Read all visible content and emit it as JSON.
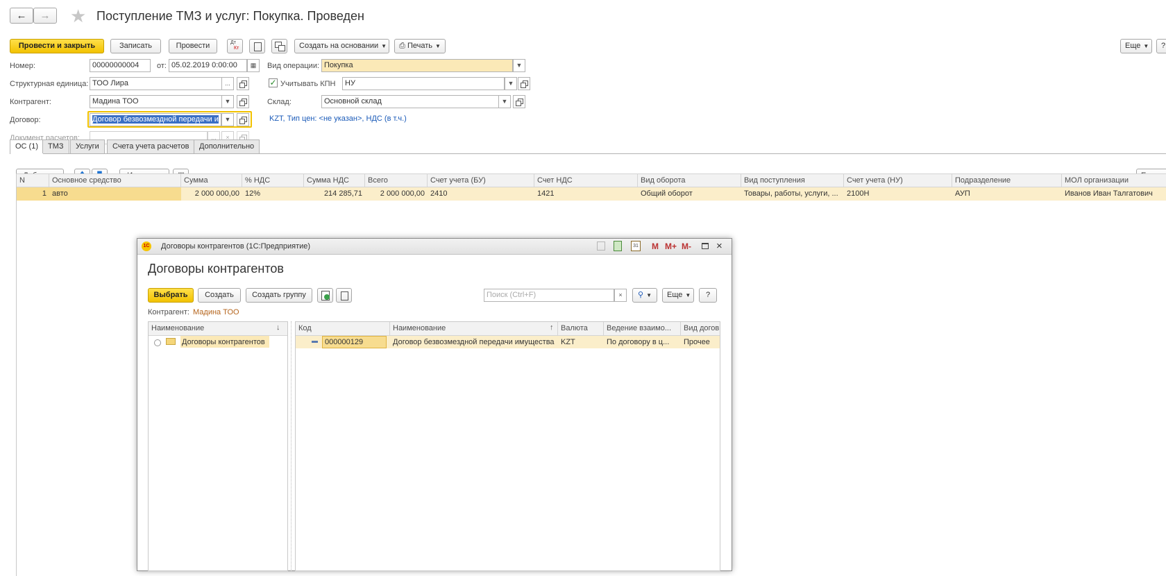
{
  "window": {
    "title": "Поступление ТМЗ и услуг: Покупка. Проведен"
  },
  "toolbar": {
    "post_close": "Провести и закрыть",
    "save": "Записать",
    "post": "Провести",
    "dt_kt": "Дт Кт",
    "create_based": "Создать на основании",
    "print": "Печать",
    "more": "Еще",
    "help": "?"
  },
  "form": {
    "number_label": "Номер:",
    "number_value": "00000000004",
    "date_label": "от:",
    "date_value": "05.02.2019  0:00:00",
    "operation_label": "Вид операции:",
    "operation_value": "Покупка",
    "unit_label": "Структурная единица:",
    "unit_value": "ТОО  Лира",
    "kpn_checkbox_label": "Учитывать  КПН",
    "kpn_value": "НУ",
    "counterparty_label": "Контрагент:",
    "counterparty_value": "Мадина ТОО",
    "warehouse_label": "Склад:",
    "warehouse_value": "Основной склад",
    "contract_label": "Договор:",
    "contract_value": "Договор безвозмездной передачи и",
    "price_info": "KZT, Тип цен: <не указан>, НДС (в т.ч.)",
    "settlement_label": "Документ расчетов:",
    "settlement_value": ""
  },
  "tabs": [
    {
      "label": "ОС (1)",
      "active": true
    },
    {
      "label": "ТМЗ",
      "active": false
    },
    {
      "label": "Услуги",
      "active": false
    },
    {
      "label": "Счета учета расчетов",
      "active": false
    },
    {
      "label": "Дополнительно",
      "active": false
    }
  ],
  "table_toolbar": {
    "add": "Добавить",
    "change": "Изменить",
    "more": "Еще"
  },
  "table": {
    "columns": [
      "N",
      "Основное средство",
      "Сумма",
      "% НДС",
      "Сумма НДС",
      "Всего",
      "Счет учета (БУ)",
      "Счет НДС",
      "Вид оборота",
      "Вид поступления",
      "Счет учета (НУ)",
      "Подразделение",
      "МОЛ организации"
    ],
    "rows": [
      [
        "1",
        "авто",
        "2 000 000,00",
        "12%",
        "214 285,71",
        "2 000 000,00",
        "2410",
        "1421",
        "Общий оборот",
        "Товары, работы, услуги, ...",
        "2100Н",
        "АУП",
        "Иванов Иван Талгатович"
      ]
    ]
  },
  "dialog": {
    "window_title": "Договоры контрагентов  (1С:Предприятие)",
    "heading": "Договоры контрагентов",
    "select": "Выбрать",
    "create": "Создать",
    "create_group": "Создать группу",
    "search_placeholder": "Поиск (Ctrl+F)",
    "more": "Еще",
    "help": "?",
    "counterparty_label": "Контрагент:",
    "counterparty_value": "Мадина ТОО",
    "m": "M",
    "m_plus": "M+",
    "m_minus": "M-",
    "tree_header": "Наименование",
    "tree_item": "Договоры контрагентов",
    "list_columns": [
      "Код",
      "Наименование",
      "Валюта",
      "Ведение взаимо...",
      "Вид догов"
    ],
    "list_rows": [
      [
        "000000129",
        "Договор безвозмездной передачи имущества",
        "KZT",
        "По договору в ц...",
        "Прочее"
      ]
    ]
  },
  "colors": {
    "accent_yellow": "#f2c200",
    "highlight_row": "#fbeeca",
    "link_blue": "#1a5ab8",
    "counterparty_orange": "#b5651d"
  }
}
